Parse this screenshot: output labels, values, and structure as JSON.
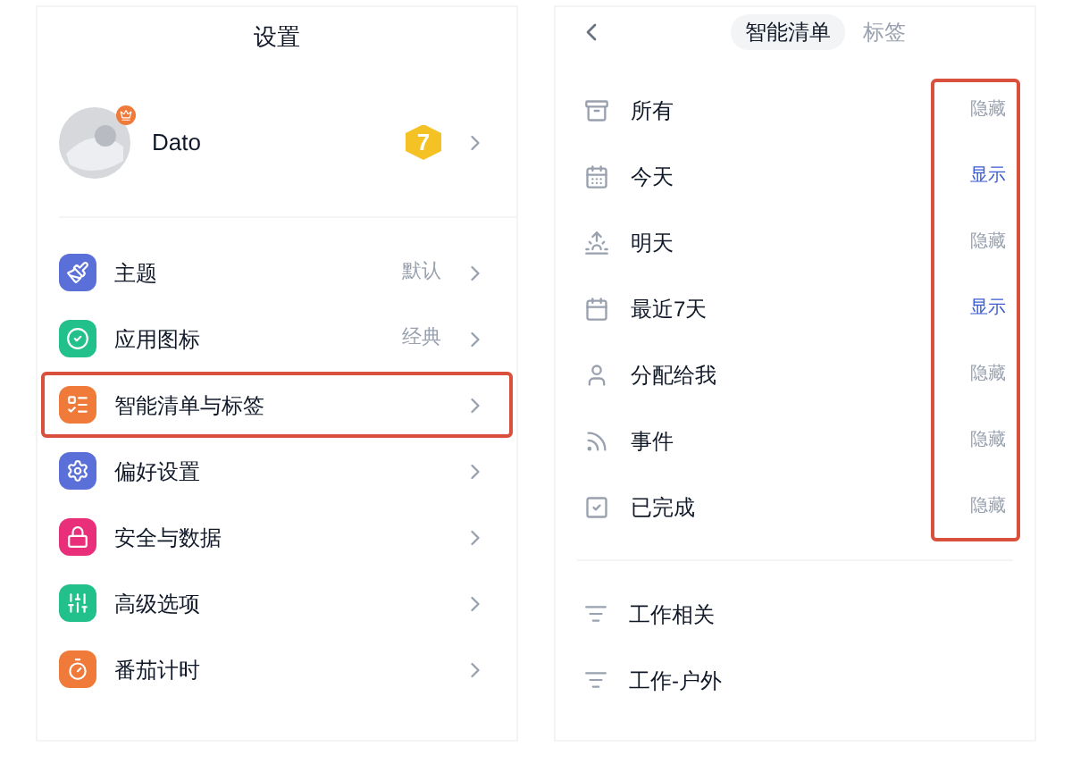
{
  "settings": {
    "title": "设置",
    "profile": {
      "name": "Dato",
      "level_badge": "7"
    },
    "items": [
      {
        "label": "主题",
        "value": "默认",
        "highlighted": false
      },
      {
        "label": "应用图标",
        "value": "经典",
        "highlighted": false
      },
      {
        "label": "智能清单与标签",
        "highlighted": true
      },
      {
        "label": "偏好设置",
        "highlighted": false
      },
      {
        "label": "安全与数据",
        "highlighted": false
      },
      {
        "label": "高级选项",
        "highlighted": false
      },
      {
        "label": "番茄计时",
        "highlighted": false
      }
    ]
  },
  "smart_lists": {
    "tabs": [
      {
        "label": "智能清单",
        "selected": true
      },
      {
        "label": "标签",
        "selected": false
      }
    ],
    "status_column_highlighted": true,
    "lists": [
      {
        "label": "所有",
        "status": "隐藏",
        "shown": false
      },
      {
        "label": "今天",
        "status": "显示",
        "shown": true
      },
      {
        "label": "明天",
        "status": "隐藏",
        "shown": false
      },
      {
        "label": "最近7天",
        "status": "显示",
        "shown": true
      },
      {
        "label": "分配给我",
        "status": "隐藏",
        "shown": false
      },
      {
        "label": "事件",
        "status": "隐藏",
        "shown": false
      },
      {
        "label": "已完成",
        "status": "隐藏",
        "shown": false
      }
    ],
    "tags": [
      {
        "label": "工作相关"
      },
      {
        "label": "工作-户外"
      }
    ]
  }
}
